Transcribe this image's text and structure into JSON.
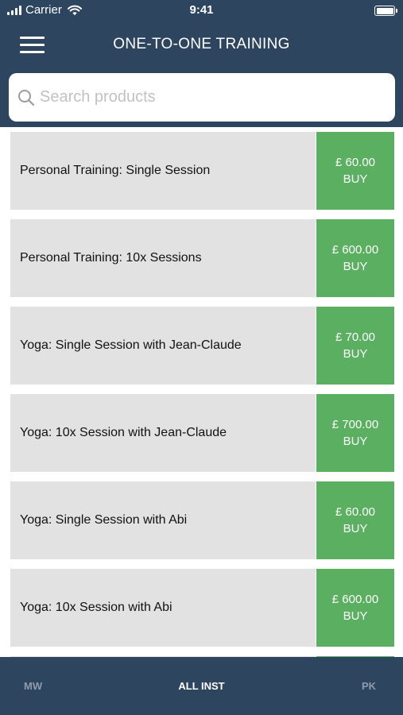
{
  "status_bar": {
    "carrier": "Carrier",
    "time": "9:41"
  },
  "header": {
    "title": "ONE-TO-ONE TRAINING",
    "menu_icon": "hamburger-menu-icon"
  },
  "search": {
    "placeholder": "Search products",
    "value": "",
    "icon": "search-icon"
  },
  "products": [
    {
      "name": "Personal Training: Single Session",
      "price": "£ 60.00",
      "buy_label": "BUY"
    },
    {
      "name": "Personal Training: 10x Sessions",
      "price": "£ 600.00",
      "buy_label": "BUY"
    },
    {
      "name": "Yoga: Single Session with Jean-Claude",
      "price": "£ 70.00",
      "buy_label": "BUY"
    },
    {
      "name": "Yoga: 10x Session with Jean-Claude",
      "price": "£ 700.00",
      "buy_label": "BUY"
    },
    {
      "name": "Yoga: Single Session with Abi",
      "price": "£ 60.00",
      "buy_label": "BUY"
    },
    {
      "name": "Yoga: 10x Session with Abi",
      "price": "£ 600.00",
      "buy_label": "BUY"
    }
  ],
  "tabs": [
    {
      "label": "MW",
      "active": false
    },
    {
      "label": "ALL INST",
      "active": true
    },
    {
      "label": "PK",
      "active": false
    }
  ],
  "colors": {
    "header_bg": "#2e4560",
    "buy_green": "#5aaf60",
    "row_bg": "#e2e2e2",
    "tab_active": "#ffffff",
    "tab_inactive": "#8d9bad"
  }
}
